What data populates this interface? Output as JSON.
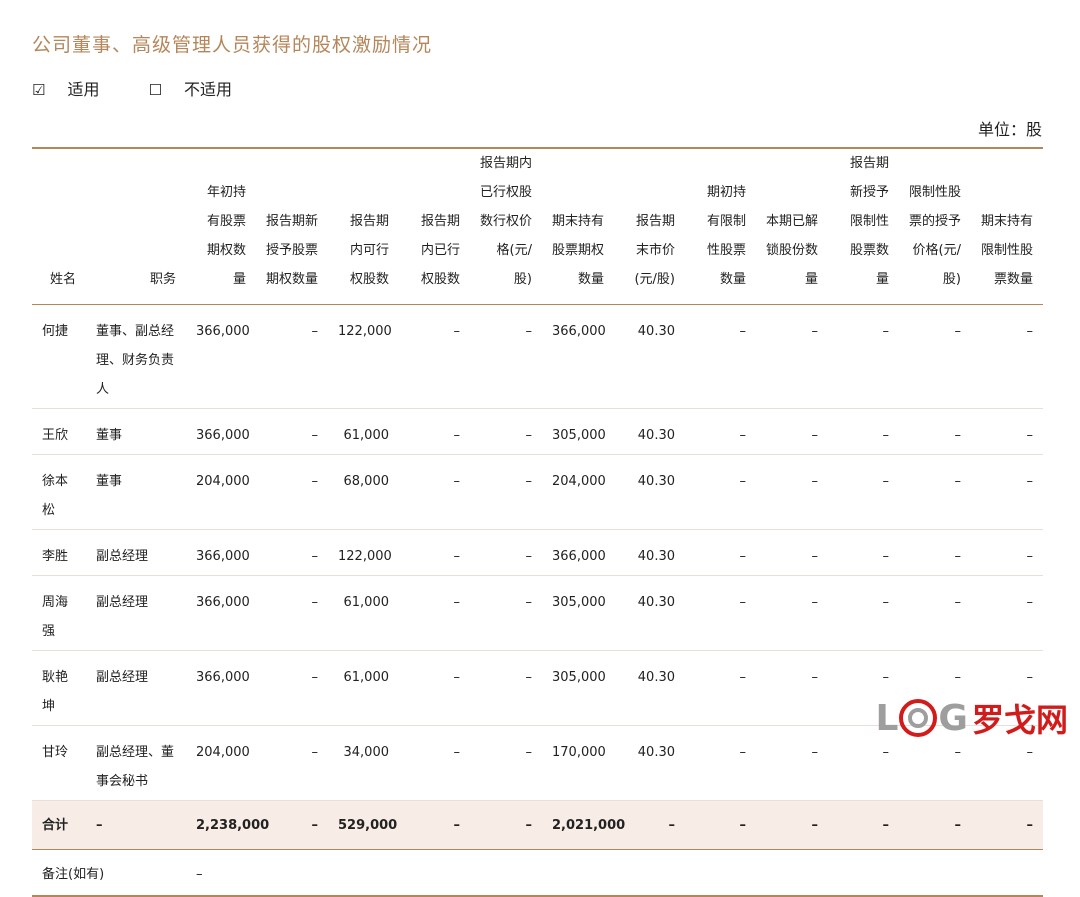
{
  "heading": "公司董事、高级管理人员获得的股权激励情况",
  "options": {
    "applicable_box": "☑",
    "applicable": "适用",
    "not_applicable_box": "☐",
    "not_applicable": "不适用"
  },
  "unit": "单位：股",
  "table": {
    "headers": [
      "姓名",
      "职务",
      "年初持有股票期权数量",
      "报告期新授予股票期权数量",
      "报告期内可行权股数",
      "报告期内已行权股数",
      "报告期内已行权股数行权价格(元/股)",
      "期末持有股票期权数量",
      "报告期末市价(元/股)",
      "期初持有限制性股票数量",
      "本期已解锁股份数量",
      "报告期新授予限制性股票数量",
      "限制性股票的授予价格(元/股)",
      "期末持有限制性股票数量"
    ],
    "rows": [
      [
        "何捷",
        "董事、副总经理、财务负责人",
        "366,000",
        "–",
        "122,000",
        "–",
        "–",
        "366,000",
        "40.30",
        "–",
        "–",
        "–",
        "–",
        "–"
      ],
      [
        "王欣",
        "董事",
        "366,000",
        "–",
        "61,000",
        "–",
        "–",
        "305,000",
        "40.30",
        "–",
        "–",
        "–",
        "–",
        "–"
      ],
      [
        "徐本松",
        "董事",
        "204,000",
        "–",
        "68,000",
        "–",
        "–",
        "204,000",
        "40.30",
        "–",
        "–",
        "–",
        "–",
        "–"
      ],
      [
        "李胜",
        "副总经理",
        "366,000",
        "–",
        "122,000",
        "–",
        "–",
        "366,000",
        "40.30",
        "–",
        "–",
        "–",
        "–",
        "–"
      ],
      [
        "周海强",
        "副总经理",
        "366,000",
        "–",
        "61,000",
        "–",
        "–",
        "305,000",
        "40.30",
        "–",
        "–",
        "–",
        "–",
        "–"
      ],
      [
        "耿艳坤",
        "副总经理",
        "366,000",
        "–",
        "61,000",
        "–",
        "–",
        "305,000",
        "40.30",
        "–",
        "–",
        "–",
        "–",
        "–"
      ],
      [
        "甘玲",
        "副总经理、董事会秘书",
        "204,000",
        "–",
        "34,000",
        "–",
        "–",
        "170,000",
        "40.30",
        "–",
        "–",
        "–",
        "–",
        "–"
      ]
    ],
    "total": [
      "合计",
      "–",
      "2,238,000",
      "–",
      "529,000",
      "–",
      "–",
      "2,021,000",
      "–",
      "–",
      "–",
      "–",
      "–",
      "–"
    ],
    "note_label": "备注(如有)",
    "note_value": "–"
  },
  "watermark": {
    "l": "L",
    "g": "G",
    "cn": "罗戈网"
  }
}
